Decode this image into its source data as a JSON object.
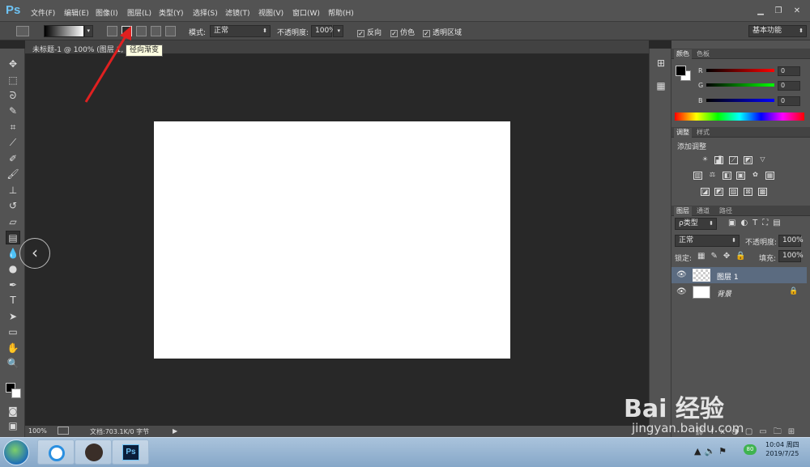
{
  "app": {
    "logo": "Ps"
  },
  "menu": [
    "文件(F)",
    "编辑(E)",
    "图像(I)",
    "图层(L)",
    "类型(Y)",
    "选择(S)",
    "滤镜(T)",
    "视图(V)",
    "窗口(W)",
    "帮助(H)"
  ],
  "options": {
    "mode_label": "模式:",
    "mode_value": "正常",
    "opacity_label": "不透明度:",
    "opacity_value": "100%",
    "reverse_label": "反向",
    "dither_label": "仿色",
    "transparency_label": "透明区域",
    "workspace": "基本功能",
    "tooltip": "径向渐变"
  },
  "document": {
    "tab_title": "未标题-1 @ 100% (图层 1, RGB/8) *",
    "zoom": "100%",
    "doc_info": "文档:703.1K/0 字节"
  },
  "color_panel": {
    "tabs": [
      "颜色",
      "色板"
    ],
    "r_label": "R",
    "g_label": "G",
    "b_label": "B",
    "r": "0",
    "g": "0",
    "b": "0"
  },
  "adjust_panel": {
    "tabs": [
      "调整",
      "样式"
    ],
    "title": "添加调整"
  },
  "layers_panel": {
    "tabs": [
      "图层",
      "通道",
      "路径"
    ],
    "filter": "ρ类型",
    "blend": "正常",
    "opacity_label": "不透明度:",
    "opacity": "100%",
    "lock_label": "锁定:",
    "fill_label": "填充:",
    "fill": "100%",
    "layers": [
      {
        "name": "图层 1"
      },
      {
        "name": "背景"
      }
    ]
  },
  "taskbar": {
    "time": "10:04 周四",
    "date": "2019/7/25",
    "badge": "80"
  },
  "watermark": {
    "brand": "Bai 经验",
    "url": "jingyan.baidu.com"
  },
  "colors": {
    "accent": "#6ec3f4",
    "layer_selected": "#5b6b80"
  }
}
